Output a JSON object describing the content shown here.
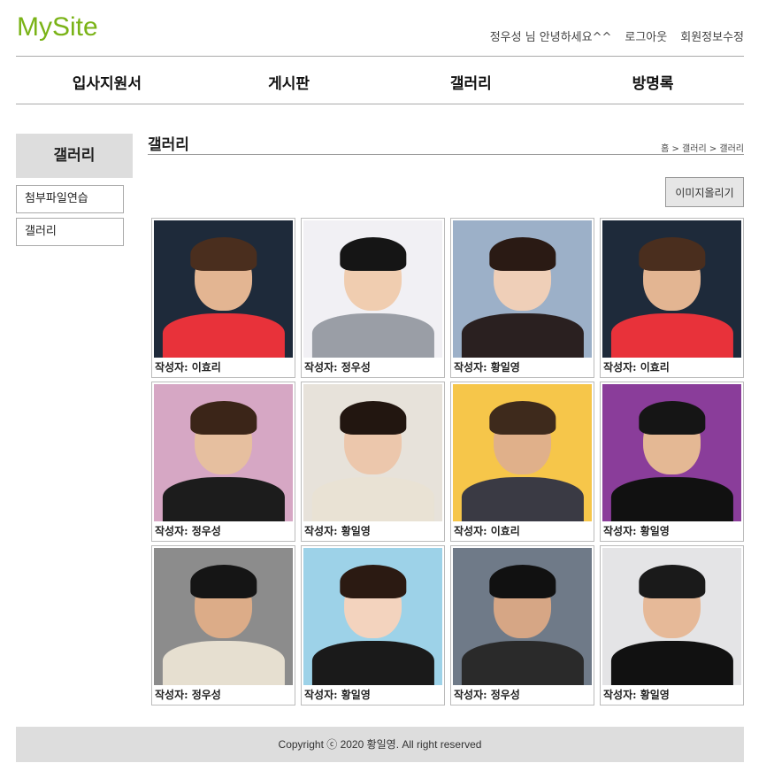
{
  "site": {
    "logo": "MySite",
    "logo_color": "#7ab317"
  },
  "top_menu": {
    "greeting": "정우성 님 안녕하세요^^",
    "logout": "로그아웃",
    "edit_profile": "회원정보수정"
  },
  "gnb": [
    "입사지원서",
    "게시판",
    "갤러리",
    "방명록"
  ],
  "lnb": {
    "title": "갤러리",
    "items": [
      "첨부파일연습",
      "갤러리"
    ]
  },
  "content": {
    "title": "갤러리",
    "breadcrumb": "홈 > 갤러리 > 갤러리",
    "upload_button": "이미지올리기"
  },
  "gallery": [
    {
      "caption": "작성자: 이효리",
      "bg": "#1e2a3a",
      "shirt": "#e8323a",
      "skin": "#e3b592",
      "hair": "#4a2e1e"
    },
    {
      "caption": "작성자: 정우성",
      "bg": "#f1f0f4",
      "shirt": "#9a9ea6",
      "skin": "#f0cdb0",
      "hair": "#151515"
    },
    {
      "caption": "작성자: 황일영",
      "bg": "#9cb0c8",
      "shirt": "#2a2020",
      "skin": "#efcfb8",
      "hair": "#2a1a14"
    },
    {
      "caption": "작성자: 이효리",
      "bg": "#1e2a3a",
      "shirt": "#e8323a",
      "skin": "#e3b592",
      "hair": "#4a2e1e"
    },
    {
      "caption": "작성자: 정우성",
      "bg": "#d6a7c4",
      "shirt": "#1c1c1c",
      "skin": "#e6bf9f",
      "hair": "#3b2518"
    },
    {
      "caption": "작성자: 황일영",
      "bg": "#e7e2da",
      "shirt": "#e9e2d4",
      "skin": "#ecc7ac",
      "hair": "#221610"
    },
    {
      "caption": "작성자: 이효리",
      "bg": "#f6c64a",
      "shirt": "#3a3a44",
      "skin": "#e0b08a",
      "hair": "#3e2a1c"
    },
    {
      "caption": "작성자: 황일영",
      "bg": "#8a3d9a",
      "shirt": "#111111",
      "skin": "#e4b894",
      "hair": "#151515"
    },
    {
      "caption": "작성자: 정우성",
      "bg": "#8c8c8c",
      "shirt": "#e6dfd0",
      "skin": "#dcac88",
      "hair": "#151515"
    },
    {
      "caption": "작성자: 황일영",
      "bg": "#9dd2e8",
      "shirt": "#1a1a1a",
      "skin": "#f3d3be",
      "hair": "#2b1a12"
    },
    {
      "caption": "작성자: 정우성",
      "bg": "#6f7a88",
      "shirt": "#2a2a2a",
      "skin": "#d6a685",
      "hair": "#111111"
    },
    {
      "caption": "작성자: 황일영",
      "bg": "#e4e4e6",
      "shirt": "#111111",
      "skin": "#e6b998",
      "hair": "#1a1a1a"
    }
  ],
  "footer": {
    "copyright": "Copyright ⓒ 2020 황일영. All right reserved"
  }
}
